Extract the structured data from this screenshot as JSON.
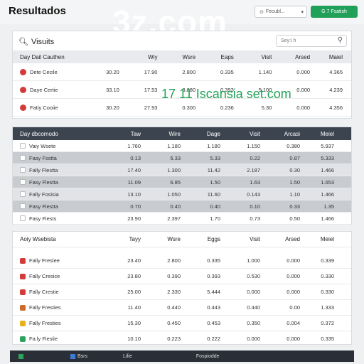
{
  "header": {
    "title": "Resultados",
    "watermark": "3z.com",
    "select_label": "Fecubl...",
    "button_label": "G 7 Fsatish"
  },
  "overlay_text": "17 11 Iscansia set.com",
  "panel1": {
    "title": "Visuits",
    "search_placeholder": "Sey:i h",
    "columns": [
      "Day Dail Cauthen",
      "",
      "Wiy",
      "Wsre",
      "Eaps",
      "Visit",
      "Arsed",
      "Maiel"
    ],
    "rows": [
      {
        "icon_color": "#d23b3b",
        "cells": [
          "Dete Cecile",
          "30.20",
          "17.90",
          "2.800",
          "0.335",
          "1.140",
          "0.000",
          "4.365"
        ]
      },
      {
        "icon_color": "#d23b3b",
        "cells": [
          "Daye Certie",
          "33.10",
          "17.53",
          "3.880",
          "0.393",
          "5.100",
          "0.000",
          "4.239"
        ]
      },
      {
        "icon_color": "#d23b3b",
        "cells": [
          "Fatiy Cooiie",
          "30.20",
          "27.93",
          "0.300",
          "0.236",
          "5.30",
          "0.000",
          "4.356"
        ]
      }
    ]
  },
  "panel2": {
    "columns": [
      "Day dbcomodo",
      "Taw",
      "Wire",
      "Dage",
      "Visit",
      "Arcasi",
      "Meiel"
    ],
    "rows": [
      {
        "cells": [
          "Vaiy Wsete",
          "1.760",
          "1.180",
          "1.180",
          "1.150",
          "0.380",
          "5.937"
        ]
      },
      {
        "cells": [
          "Fasy Fsstta",
          "0.13",
          "5.33",
          "5.33",
          "0.22",
          "0.87",
          "5.333"
        ]
      },
      {
        "cells": [
          "Fally Flestta",
          "17.40",
          "1.300",
          "11.42",
          "2.187",
          "0.30",
          "1.466"
        ]
      },
      {
        "cells": [
          "Fasy Flestta",
          "11.09",
          "6.85",
          "1.50",
          "1.63",
          "1.50",
          "1.653"
        ]
      },
      {
        "cells": [
          "Fally Fosisia",
          "13.10",
          "1.050",
          "11.60",
          "0.143",
          "1.10",
          "1.466"
        ]
      },
      {
        "cells": [
          "Fasy Fiestta",
          "0.70",
          "0.40",
          "0.40",
          "0.10",
          "0.33",
          "1.35"
        ]
      },
      {
        "cells": [
          "Fasy Fiests",
          "23.90",
          "2.397",
          "1.70",
          "0.73",
          "0.50",
          "1.466"
        ]
      }
    ]
  },
  "panel3": {
    "columns": [
      "Aoiy Wsebista",
      "Tayy",
      "Wsre",
      "Eggs",
      "Visit",
      "Arsed",
      "Meiel"
    ],
    "rows": [
      {
        "icon_color": "#d33b3b",
        "cells": [
          "Fally Freslee",
          "23.40",
          "2.800",
          "0.335",
          "1.000",
          "0.000",
          "0.339"
        ]
      },
      {
        "icon_color": "#d33b3b",
        "cells": [
          "Fally Cresice",
          "23.80",
          "0.390",
          "0.393",
          "0.530",
          "0.000",
          "0.330"
        ]
      },
      {
        "icon_color": "#d33b3b",
        "cells": [
          "Fally Crestie",
          "25.00",
          "2.330",
          "5.444",
          "0.000",
          "0.000",
          "0.330"
        ]
      },
      {
        "icon_color": "#cc6a2a",
        "cells": [
          "Fally Fresties",
          "11.40",
          "0.440",
          "0.443",
          "0.440",
          "0.00",
          "1.333"
        ]
      },
      {
        "icon_color": "#e3b21e",
        "cells": [
          "Fally Fresties",
          "15.30",
          "0.450",
          "0.453",
          "0.350",
          "0.004",
          "0.372"
        ]
      },
      {
        "icon_color": "#2ba35c",
        "cells": [
          "Fa.ly Fieslie",
          "10.10",
          "0.223",
          "0.222",
          "0.000",
          "0.000",
          "0.335"
        ]
      }
    ]
  },
  "taskbar": {
    "items": [
      "Bsrs",
      "Lifie",
      "Fospiodde"
    ]
  },
  "colors": {
    "accent_green": "#21a05a",
    "dark_header": "#3c4450",
    "row_shade": "#c8cbcf"
  }
}
